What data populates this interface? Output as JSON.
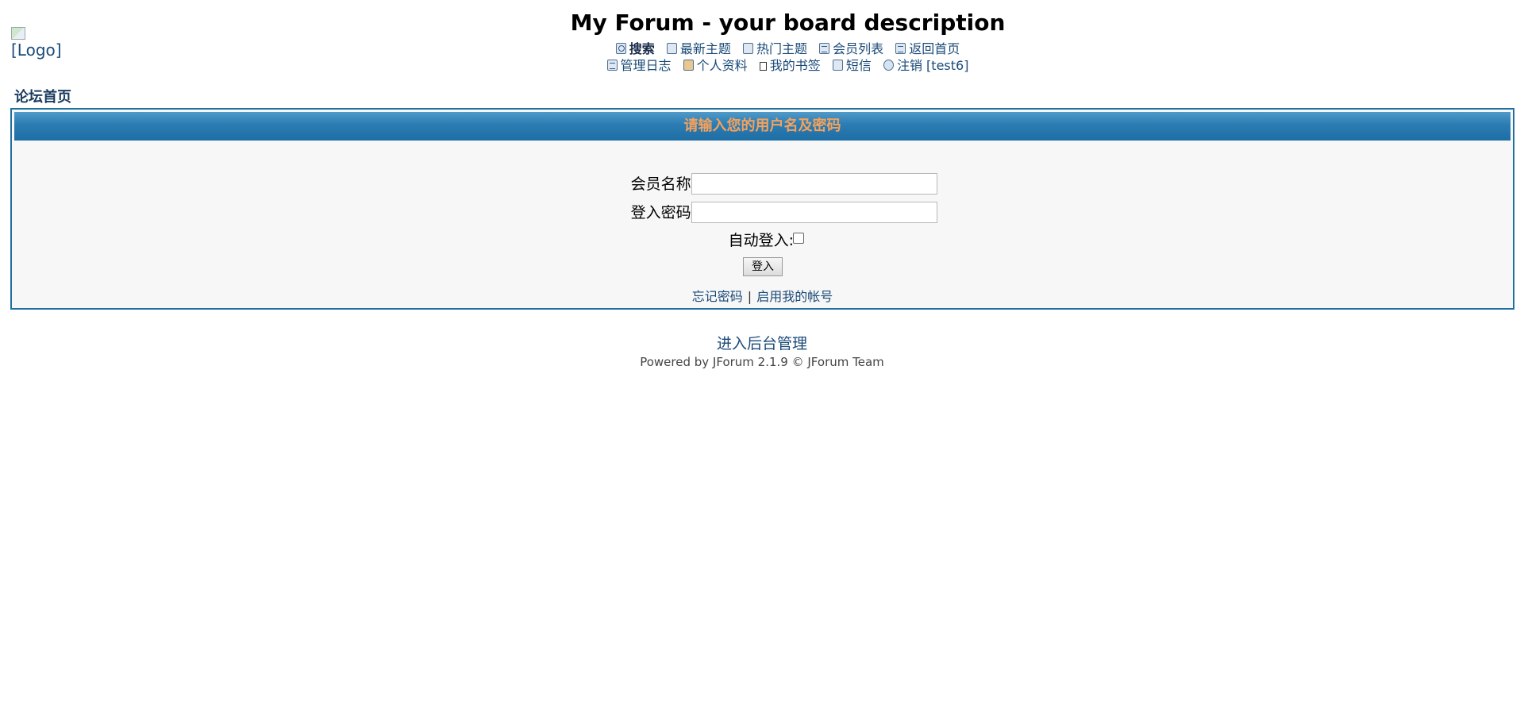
{
  "header": {
    "logo_alt": "[Logo]",
    "title": "My Forum - your board description"
  },
  "nav": {
    "row1": [
      {
        "label": "搜索",
        "icon": "search-icon"
      },
      {
        "label": "最新主题",
        "icon": "recent-topics-icon"
      },
      {
        "label": "热门主题",
        "icon": "hot-topics-icon"
      },
      {
        "label": "会员列表",
        "icon": "member-list-icon"
      },
      {
        "label": "返回首页",
        "icon": "home-icon"
      }
    ],
    "row2": [
      {
        "label": "管理日志",
        "icon": "moderation-log-icon"
      },
      {
        "label": "个人资料",
        "icon": "profile-icon"
      },
      {
        "label": "我的书签",
        "icon": "bookmark-icon"
      },
      {
        "label": "短信",
        "icon": "private-message-icon"
      },
      {
        "label": "注销 [test6]",
        "icon": "logout-icon"
      }
    ]
  },
  "breadcrumb": "论坛首页",
  "login": {
    "heading": "请输入您的用户名及密码",
    "username_label": "会员名称:",
    "username_value": "",
    "password_label": "登入密码:",
    "password_value": "",
    "autologin_label": "自动登入:",
    "autologin_checked": false,
    "submit_label": "登入",
    "forgot_password": "忘记密码",
    "separator": "|",
    "activate_account": "启用我的帐号"
  },
  "footer": {
    "admin_link": "进入后台管理",
    "powered_by": "Powered by JForum 2.1.9 © JForum Team"
  },
  "colors": {
    "header_gradient_top": "#4f9ac9",
    "header_gradient_bottom": "#1e6ea6",
    "header_text": "#f4a15c",
    "link": "#1a4a78",
    "panel_border": "#1f6f9f",
    "panel_bg": "#f7f7f7"
  }
}
